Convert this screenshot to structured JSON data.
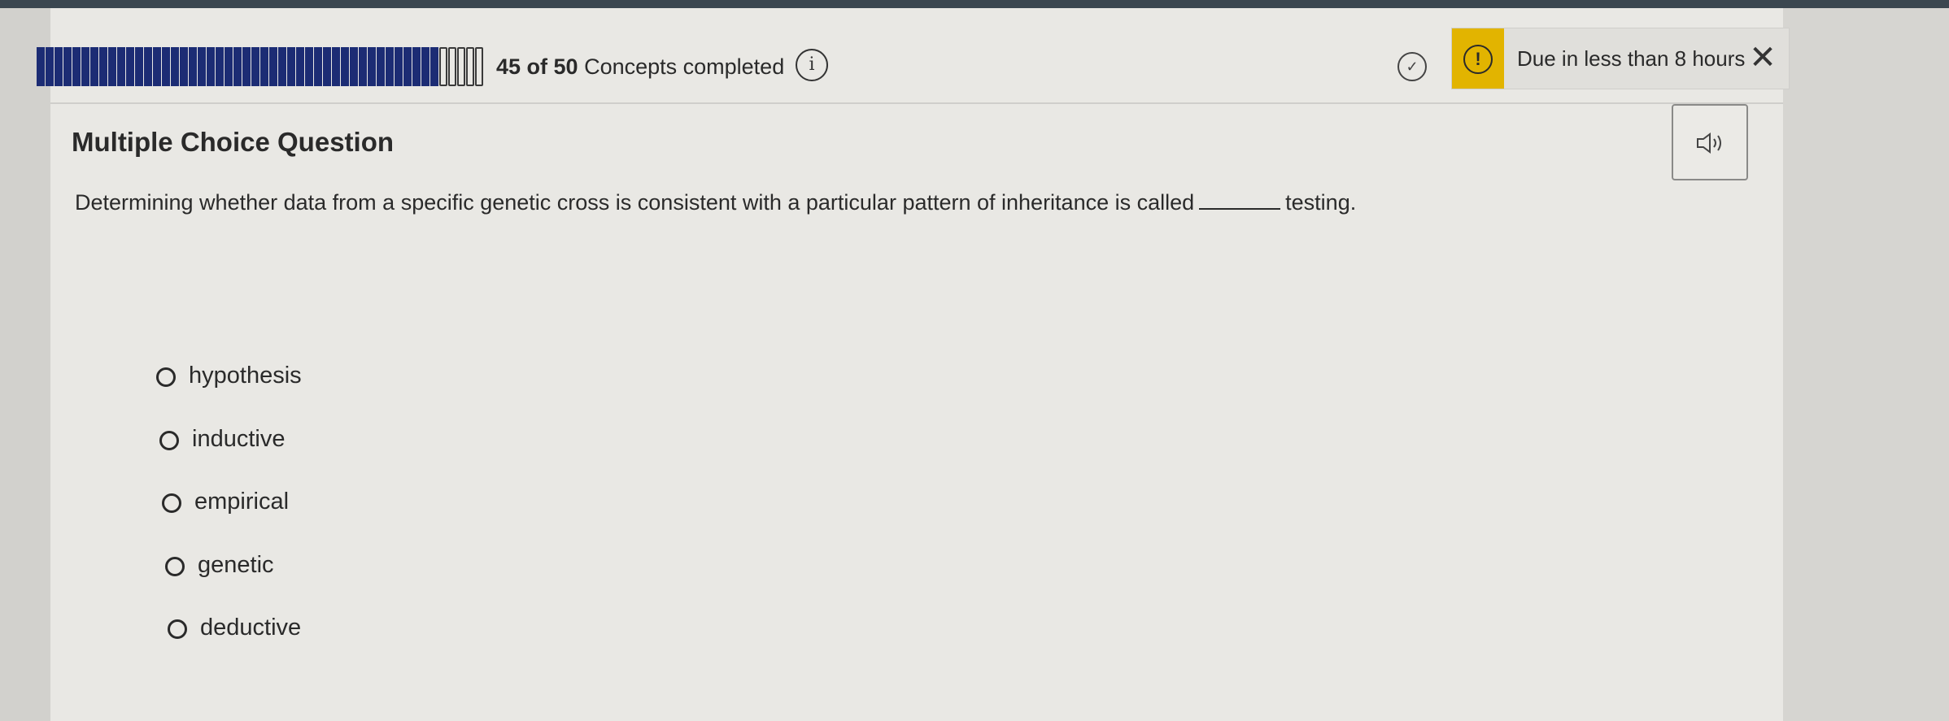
{
  "progress": {
    "completed": 45,
    "total": 50,
    "text_count": "45 of 50",
    "text_suffix": "Concepts completed"
  },
  "icons": {
    "info": "info-icon",
    "check": "check-circle-icon",
    "warning": "warning-icon",
    "close": "close-icon",
    "audio": "speaker-icon"
  },
  "due": {
    "text": "Due in less than 8 hours",
    "warning_glyph": "!",
    "close_glyph": "✕"
  },
  "question": {
    "type_label": "Multiple Choice Question",
    "text_before": "Determining whether data from a specific genetic cross is consistent with a particular pattern of inheritance is called",
    "text_after": "testing."
  },
  "options": [
    {
      "label": "hypothesis"
    },
    {
      "label": "inductive"
    },
    {
      "label": "empirical"
    },
    {
      "label": "genetic"
    },
    {
      "label": "deductive"
    }
  ],
  "colors": {
    "progress_fill": "#1c2c74",
    "warning": "#e2b400"
  }
}
